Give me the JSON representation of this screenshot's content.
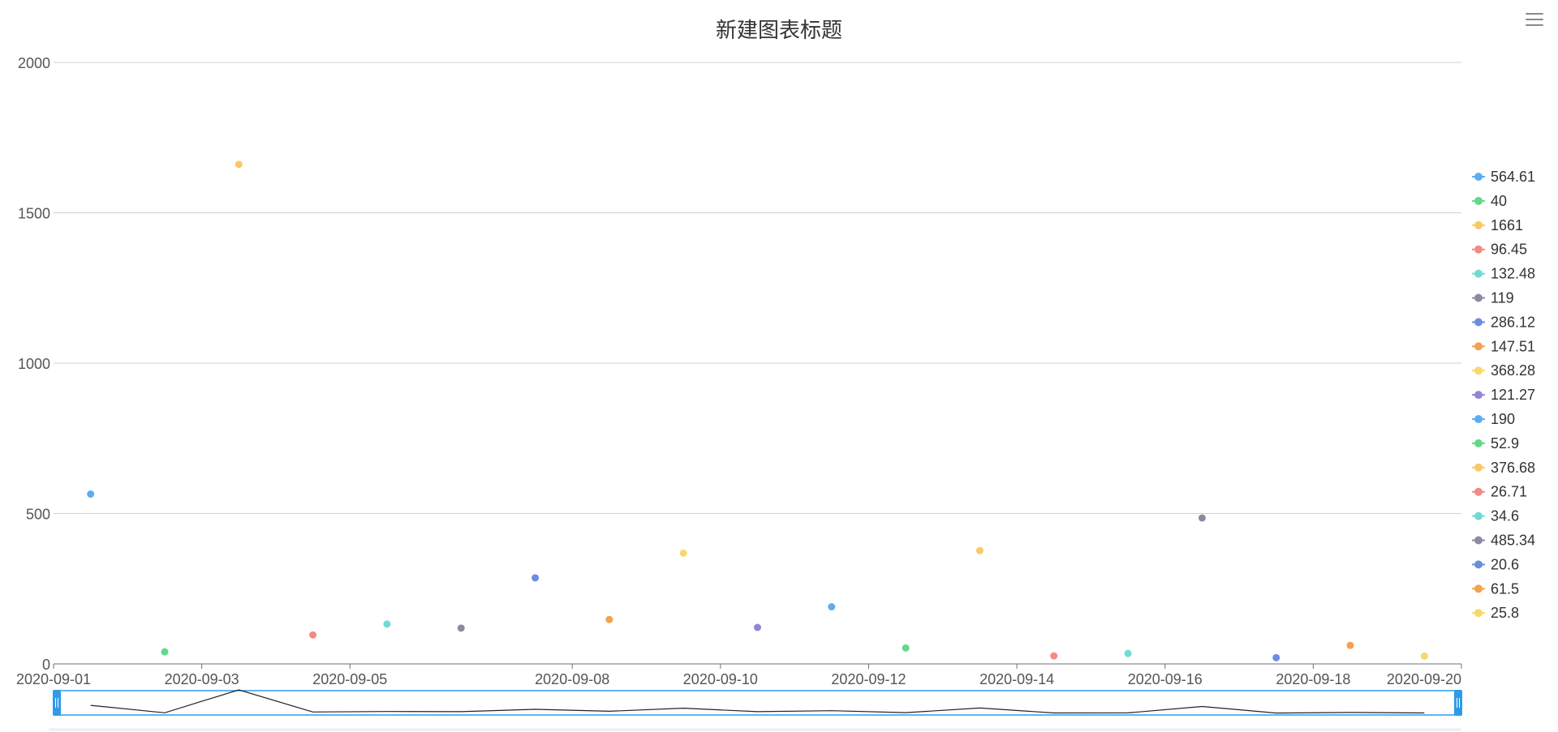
{
  "chart_data": {
    "type": "scatter",
    "title": "新建图表标题",
    "ylim": [
      0,
      2000
    ],
    "y_ticks": [
      0,
      500,
      1000,
      1500,
      2000
    ],
    "x_tick_labels": [
      "2020-09-01",
      "2020-09-03",
      "2020-09-05",
      "2020-09-08",
      "2020-09-10",
      "2020-09-12",
      "2020-09-14",
      "2020-09-16",
      "2020-09-18",
      "2020-09-20"
    ],
    "grid": true,
    "legend_position": "right",
    "data_zoom": true,
    "series": [
      {
        "name": "564.61",
        "x": "2020-09-01",
        "y": 564.61,
        "color": "#5aaef3"
      },
      {
        "name": "40",
        "x": "2020-09-02",
        "y": 40,
        "color": "#62d98a"
      },
      {
        "name": "1661",
        "x": "2020-09-03",
        "y": 1661,
        "color": "#f9c965"
      },
      {
        "name": "96.45",
        "x": "2020-09-04",
        "y": 96.45,
        "color": "#f38b83"
      },
      {
        "name": "132.48",
        "x": "2020-09-05",
        "y": 132.48,
        "color": "#6fdbd4"
      },
      {
        "name": "119",
        "x": "2020-09-06",
        "y": 119,
        "color": "#8c8aa2"
      },
      {
        "name": "286.12",
        "x": "2020-09-07",
        "y": 286.12,
        "color": "#6b8de0"
      },
      {
        "name": "147.51",
        "x": "2020-09-08",
        "y": 147.51,
        "color": "#f2a250"
      },
      {
        "name": "368.28",
        "x": "2020-09-09",
        "y": 368.28,
        "color": "#f6d96b"
      },
      {
        "name": "121.27",
        "x": "2020-09-10",
        "y": 121.27,
        "color": "#9088d6"
      },
      {
        "name": "190",
        "x": "2020-09-11",
        "y": 190,
        "color": "#5aaef3"
      },
      {
        "name": "52.9",
        "x": "2020-09-12",
        "y": 52.9,
        "color": "#62d98a"
      },
      {
        "name": "376.68",
        "x": "2020-09-13",
        "y": 376.68,
        "color": "#f9c965"
      },
      {
        "name": "26.71",
        "x": "2020-09-14",
        "y": 26.71,
        "color": "#f38b83"
      },
      {
        "name": "34.6",
        "x": "2020-09-15",
        "y": 34.6,
        "color": "#6fdbd4"
      },
      {
        "name": "485.34",
        "x": "2020-09-16",
        "y": 485.34,
        "color": "#8c8aa2"
      },
      {
        "name": "20.6",
        "x": "2020-09-17",
        "y": 20.6,
        "color": "#6b8de0"
      },
      {
        "name": "61.5",
        "x": "2020-09-18",
        "y": 61.5,
        "color": "#f2a250"
      },
      {
        "name": "25.8",
        "x": "2020-09-19",
        "y": 25.8,
        "color": "#f6d96b"
      }
    ]
  }
}
